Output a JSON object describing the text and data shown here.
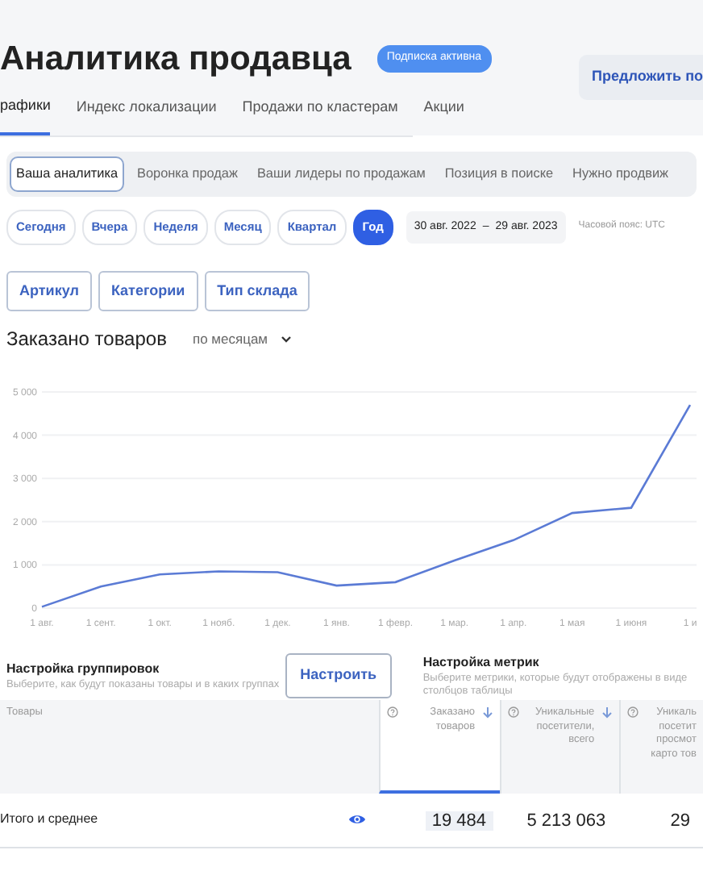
{
  "header": {
    "title": "Аналитика продавца",
    "badge": "Подписка активна",
    "action_button": "Предложить по"
  },
  "nav_tabs": [
    {
      "label": "рафики",
      "selected": true
    },
    {
      "label": "Индекс локализации",
      "selected": false
    },
    {
      "label": "Продажи по кластерам",
      "selected": false
    },
    {
      "label": "Акции",
      "selected": false
    }
  ],
  "section_tabs": [
    {
      "label": "Ваша аналитика",
      "selected": true
    },
    {
      "label": "Воронка продаж",
      "selected": false
    },
    {
      "label": "Ваши лидеры по продажам",
      "selected": false
    },
    {
      "label": "Позиция в поиске",
      "selected": false
    },
    {
      "label": "Нужно продвиж",
      "selected": false
    }
  ],
  "periods": [
    {
      "label": "Сегодня",
      "selected": false
    },
    {
      "label": "Вчера",
      "selected": false
    },
    {
      "label": "Неделя",
      "selected": false
    },
    {
      "label": "Месяц",
      "selected": false
    },
    {
      "label": "Квартал",
      "selected": false
    },
    {
      "label": "Год",
      "selected": true
    }
  ],
  "date_range": {
    "from": "30 авг. 2022",
    "separator": "–",
    "to": "29 авг. 2023"
  },
  "timezone": "Часовой пояс: UTC",
  "group_buttons": [
    "Артикул",
    "Категории",
    "Тип склада"
  ],
  "chart": {
    "title": "Заказано товаров",
    "period_select": "по месяцам",
    "chart_data": {
      "type": "line",
      "categories": [
        "1 авг.",
        "1 сент.",
        "1 окт.",
        "1 нояб.",
        "1 дек.",
        "1 янв.",
        "1 февр.",
        "1 мар.",
        "1 апр.",
        "1 мая",
        "1 июня",
        "1 и"
      ],
      "ylim": [
        0,
        5000
      ],
      "yticks": [
        0,
        1000,
        2000,
        3000,
        4000,
        {
          "value": 5000,
          "label": "5 000"
        }
      ],
      "grid": true,
      "series": [
        {
          "color": "#5b7bd5",
          "values": [
            30,
            500,
            780,
            850,
            830,
            520,
            600,
            1100,
            1570,
            2200,
            2320,
            4700
          ]
        }
      ]
    }
  },
  "grouping_settings": {
    "title": "Настройка группировок",
    "hint": "Выберите, как будут показаны товары и в каких группах",
    "button": "Настроить"
  },
  "metric_settings": {
    "title": "Настройка метрик",
    "hint": "Выберите метрики, которые будут отображены в виде столбцов таблицы"
  },
  "table": {
    "columns": [
      {
        "label": "Товары",
        "selected": false
      },
      {
        "label": "Заказано товаров",
        "selected": true
      },
      {
        "label": "Уникальные посетители, всего",
        "selected": false
      },
      {
        "label": "Уникаль посетит просмот карто тов",
        "selected": false
      }
    ],
    "rows": [
      {
        "cells": [
          "Итого и среднее",
          "19 484",
          "5 213 063",
          "29"
        ]
      }
    ]
  }
}
